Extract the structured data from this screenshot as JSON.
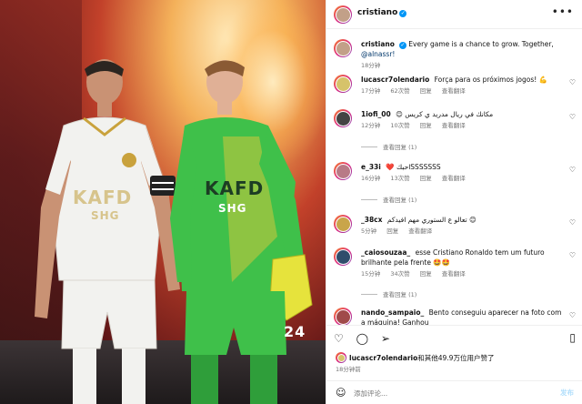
{
  "post": {
    "author": "cristiano",
    "caption": "Every game is a chance to grow. Together,",
    "caption_mention": "@alnassr!",
    "caption_time": "18分钟",
    "more_icon": "more-horizontal-icon"
  },
  "photo": {
    "jersey_white_brand": "KAFD",
    "jersey_white_sponsor": "SHG",
    "jersey_green_brand": "KAFD",
    "jersey_green_sponsor": "SHG",
    "jersey_number": "24",
    "colors": {
      "white_kit": "#f2f2ef",
      "green_kit": "#3fc04a",
      "gold": "#c9a23c"
    }
  },
  "comments": [
    {
      "user": "lucascr7olendario",
      "text": "Força para os próximos jogos! 💪",
      "time": "17分钟",
      "likes": "62次赞",
      "reply": "回复",
      "translate": "查看翻译",
      "replies": ""
    },
    {
      "user": "1iofi_00",
      "text": "😊 مكانك في ريال مدريد ي كريس",
      "time": "12分钟",
      "likes": "10次赞",
      "reply": "回复",
      "translate": "查看翻译",
      "replies": "查看回复 (1)"
    },
    {
      "user": "e_33i",
      "text": "❤️ احبكSSSSSSS",
      "time": "16分钟",
      "likes": "13次赞",
      "reply": "回复",
      "translate": "查看翻译",
      "replies": "查看回复 (1)"
    },
    {
      "user": "_38cx",
      "text": "تعالو ع الستوري مهم افيدكم 😊",
      "time": "5分钟",
      "likes": "",
      "reply": "回复",
      "translate": "查看翻译",
      "replies": ""
    },
    {
      "user": "_caiosouzaa_",
      "text": "esse Cristiano Ronaldo tem um futuro brilhante pela frente 🤩🤩",
      "time": "15分钟",
      "likes": "34次赞",
      "reply": "回复",
      "translate": "查看翻译",
      "replies": "查看回复 (1)"
    },
    {
      "user": "nando_sampaio_",
      "text": "Bento conseguiu aparecer na foto com a máquina! Ganhou",
      "time": "",
      "likes": "",
      "reply": "",
      "translate": "",
      "replies": ""
    }
  ],
  "actions": {
    "liked_by_user": "lucascr7olendario",
    "liked_by_rest": "和其他49.9万位用户赞了",
    "time": "18分钟前"
  },
  "compose": {
    "placeholder": "添加评论...",
    "post_label": "发布"
  }
}
